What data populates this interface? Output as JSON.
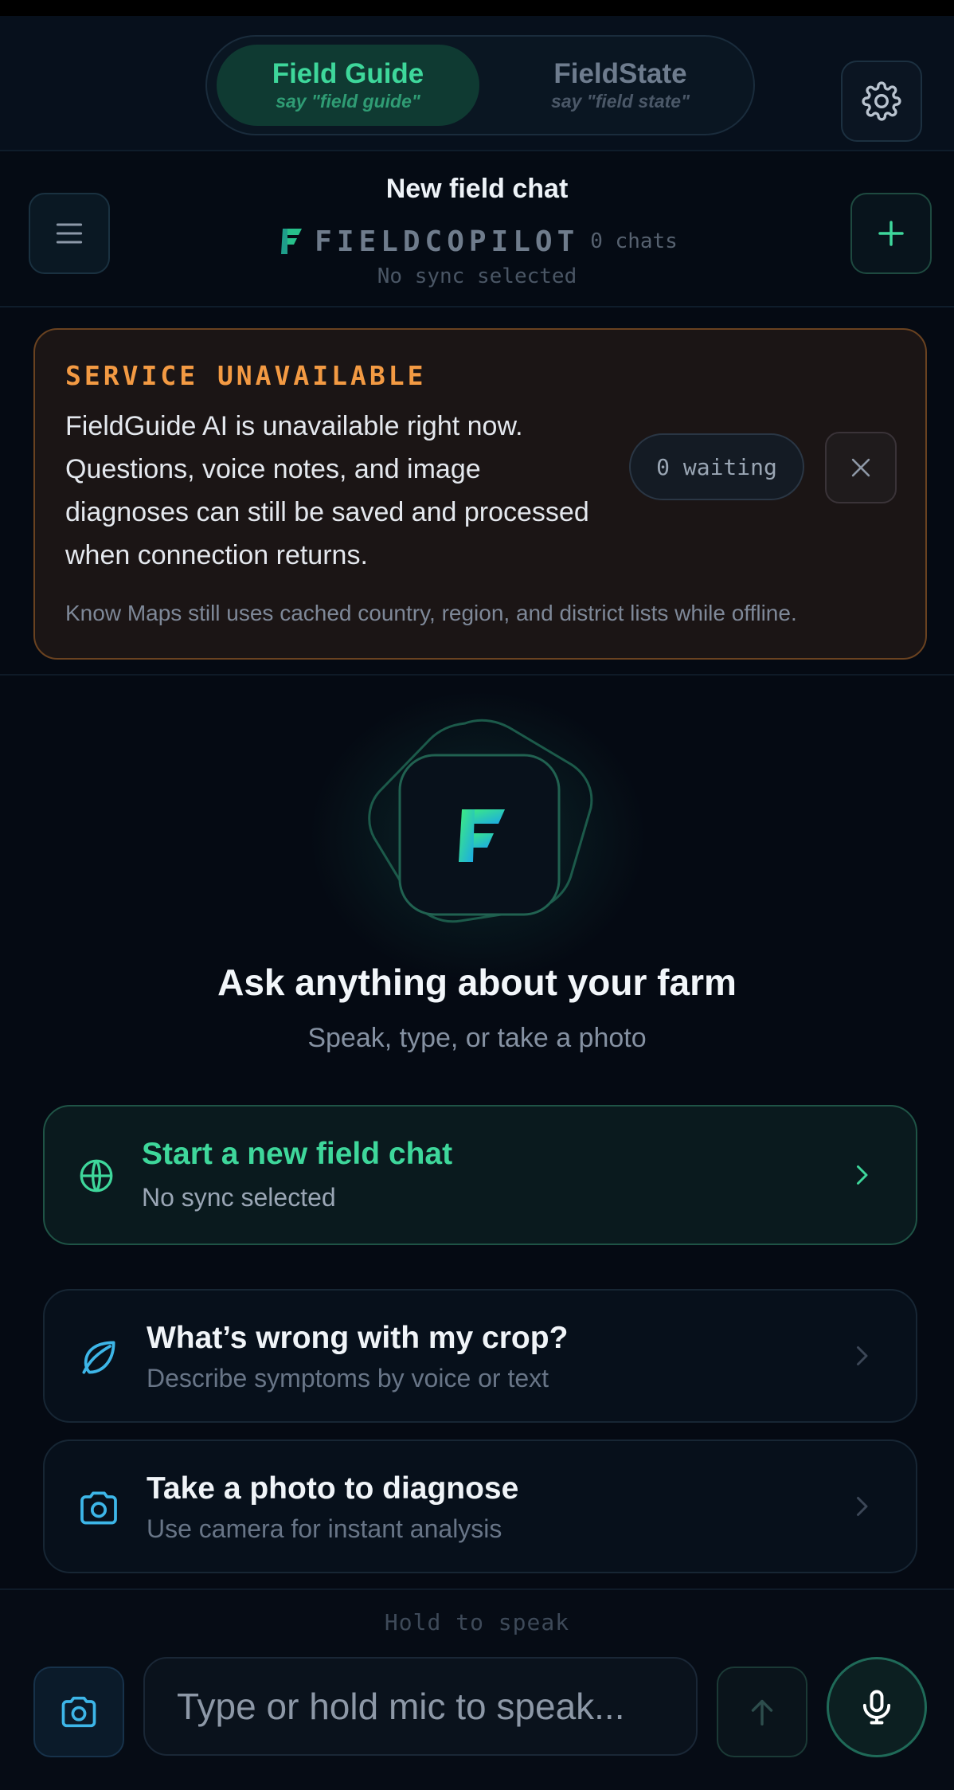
{
  "colors": {
    "accent": "#3ed79b",
    "warning": "#f39a43",
    "background": "#050a13"
  },
  "mode_switch": {
    "field_guide": {
      "title": "Field Guide",
      "hint": "say \"field guide\"",
      "active": true
    },
    "field_state": {
      "title": "FieldState",
      "hint": "say \"field state\"",
      "active": false
    }
  },
  "header": {
    "title": "New field chat",
    "brand": "FIELDCOPILOT",
    "chat_count": "0 chats",
    "sync_status": "No sync selected"
  },
  "banner": {
    "title": "SERVICE UNAVAILABLE",
    "message": "FieldGuide AI is unavailable right now. Questions, voice notes, and image diagnoses can still be saved and processed when connection returns.",
    "waiting": "0 waiting",
    "footnote": "Know Maps still uses cached country, region, and district lists while offline."
  },
  "hero": {
    "title": "Ask anything about your farm",
    "subtitle": "Speak, type, or take a photo"
  },
  "cards": [
    {
      "title": "Start a new field chat",
      "subtitle": "No sync selected",
      "icon": "globe-icon"
    },
    {
      "title": "What’s wrong with my crop?",
      "subtitle": "Describe symptoms by voice or text",
      "icon": "leaf-icon"
    },
    {
      "title": "Take a photo to diagnose",
      "subtitle": "Use camera for instant analysis",
      "icon": "camera-icon"
    }
  ],
  "composer": {
    "hold_label": "Hold to speak",
    "placeholder": "Type or hold mic to speak..."
  }
}
